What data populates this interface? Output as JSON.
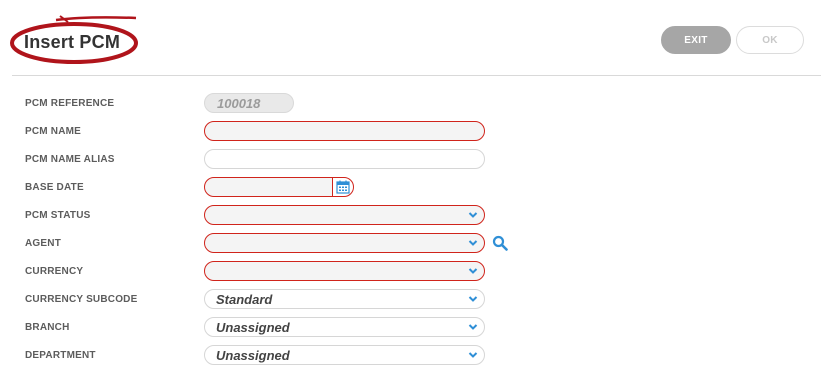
{
  "header": {
    "title": "Insert PCM",
    "exit_label": "EXIT",
    "ok_label": "OK"
  },
  "form": {
    "fields": [
      {
        "label": "PCM REFERENCE",
        "value": "100018"
      },
      {
        "label": "PCM NAME",
        "value": ""
      },
      {
        "label": "PCM NAME ALIAS",
        "value": ""
      },
      {
        "label": "BASE DATE",
        "value": ""
      },
      {
        "label": "PCM STATUS",
        "value": ""
      },
      {
        "label": "AGENT",
        "value": ""
      },
      {
        "label": "CURRENCY",
        "value": ""
      },
      {
        "label": "CURRENCY SUBCODE",
        "value": "Standard"
      },
      {
        "label": "BRANCH",
        "value": "Unassigned"
      },
      {
        "label": "DEPARTMENT",
        "value": "Unassigned"
      }
    ]
  },
  "colors": {
    "required_border": "#d0241b",
    "accent_blue": "#2f8fd6",
    "exit_bg": "#a6a6a6"
  },
  "icons": [
    "calendar-icon",
    "search-icon",
    "chevron-down-icon"
  ]
}
